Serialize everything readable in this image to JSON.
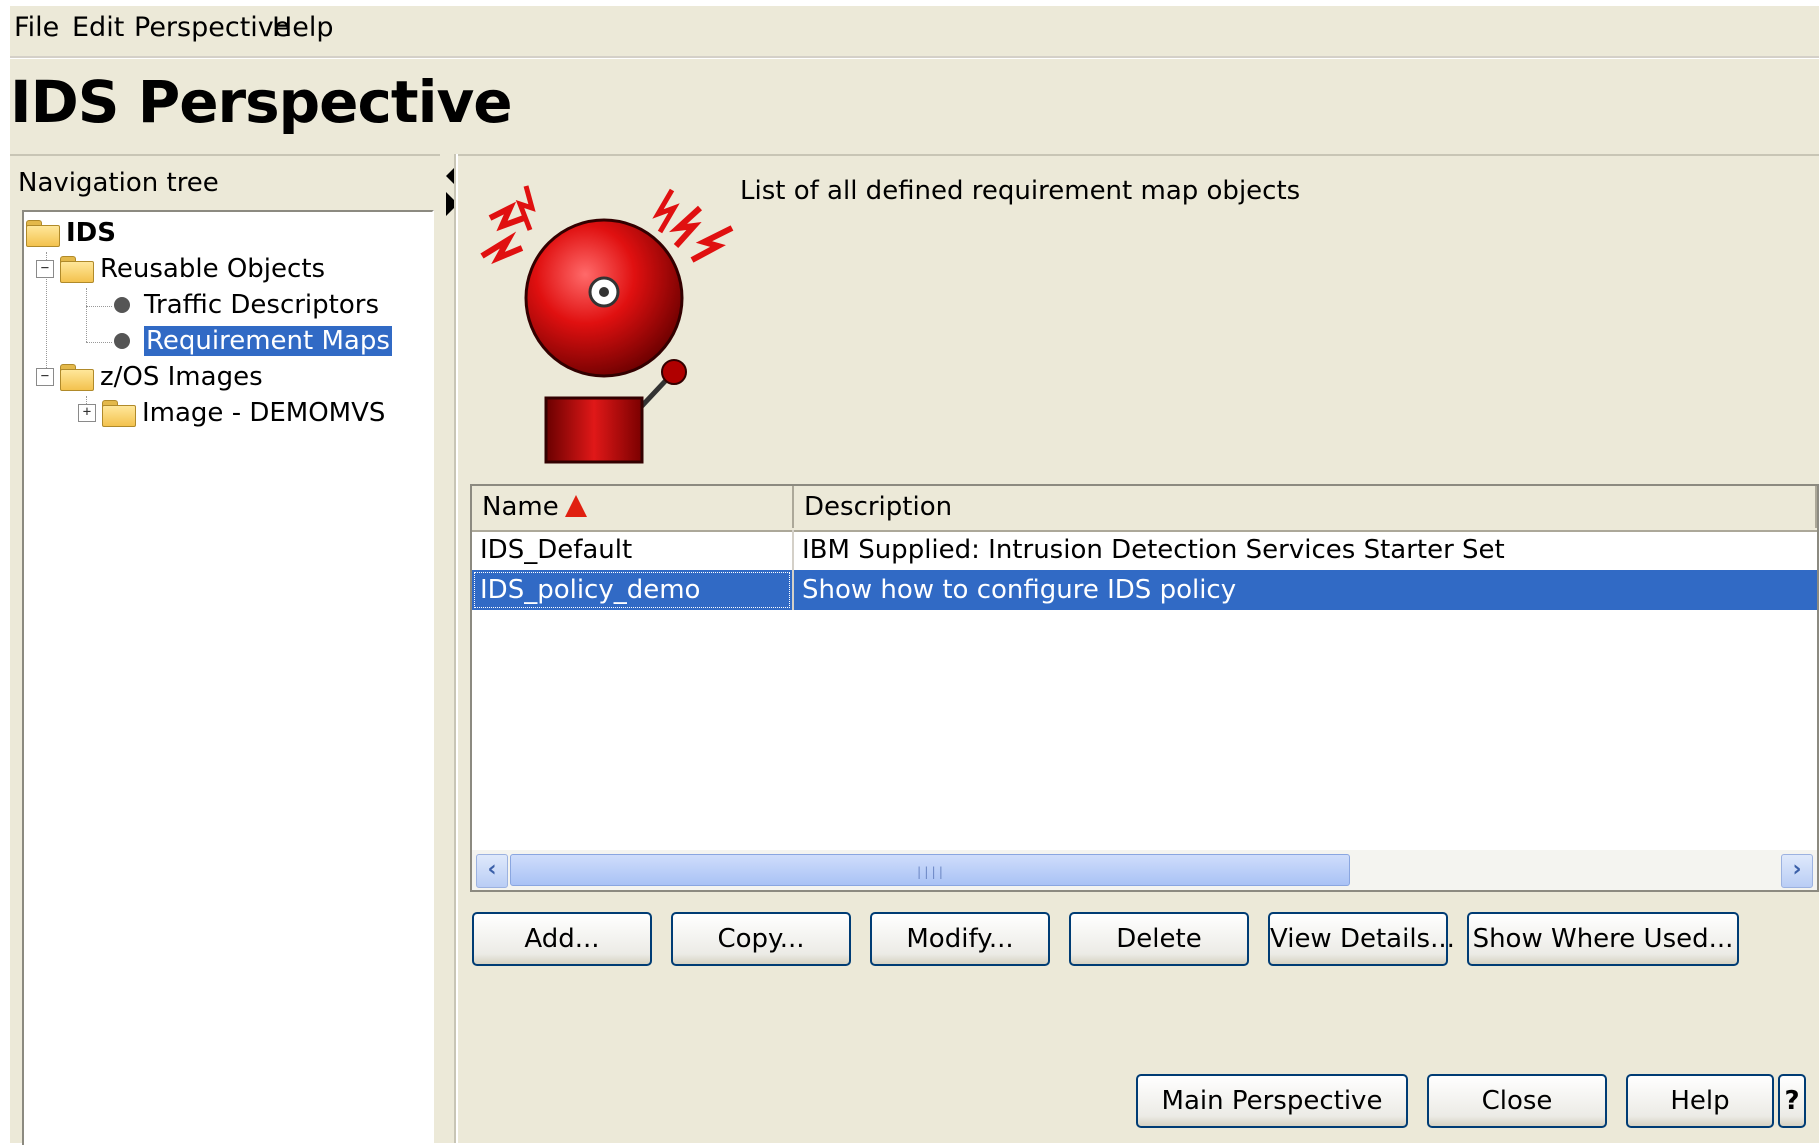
{
  "menu": {
    "items": [
      "File",
      "Edit",
      "Perspective",
      "Help"
    ]
  },
  "page_title": "IDS Perspective",
  "nav": {
    "label": "Navigation tree",
    "tree": {
      "root": "IDS",
      "reusable_objects": "Reusable Objects",
      "traffic_descriptors": "Traffic Descriptors",
      "requirement_maps": "Requirement Maps",
      "zos_images": "z/OS Images",
      "image_demomvs": "Image - DEMOMVS"
    }
  },
  "main": {
    "description": "List of all defined requirement map objects",
    "icon": "alarm-bell-icon",
    "table": {
      "columns": [
        "Name",
        "Description"
      ],
      "sort_column": "Name",
      "rows": [
        {
          "name": "IDS_Default",
          "description": "IBM Supplied: Intrusion Detection Services Starter Set",
          "selected": false
        },
        {
          "name": "IDS_policy_demo",
          "description": "Show how to configure IDS policy",
          "selected": true
        }
      ]
    },
    "actions": {
      "add": "Add...",
      "copy": "Copy...",
      "modify": "Modify...",
      "delete": "Delete",
      "view_details": "View Details...",
      "show_where_used": "Show Where Used..."
    }
  },
  "footer": {
    "main_perspective": "Main Perspective",
    "close": "Close",
    "help": "Help",
    "help_icon": "?"
  },
  "colors": {
    "window_bg": "#ece9d8",
    "selection": "#316ac5",
    "button_border": "#003c74"
  }
}
